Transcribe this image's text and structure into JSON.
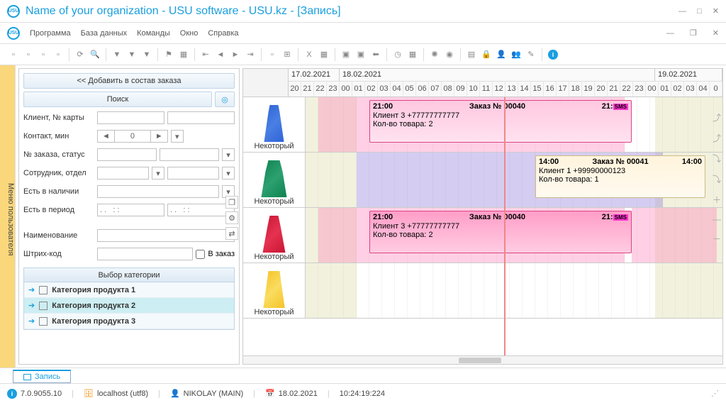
{
  "window": {
    "title": "Name of your organization - USU software - USU.kz - [Запись]"
  },
  "menu": {
    "program": "Программа",
    "database": "База данных",
    "commands": "Команды",
    "window": "Окно",
    "help": "Справка"
  },
  "sidebar_tab": "Меню пользователя",
  "left": {
    "add_to_order": "<< Добавить в состав заказа",
    "search": "Поиск",
    "client_card": "Клиент, № карты",
    "contact_min": "Контакт, мин",
    "contact_val": "0",
    "order_status": "№ заказа, статус",
    "employee_dept": "Сотрудник, отдел",
    "in_stock": "Есть в наличии",
    "in_period": "Есть в период",
    "period_ph": ". .   : :",
    "name": "Наименование",
    "barcode": "Штрих-код",
    "in_order": "В заказ",
    "cat_header": "Выбор категории",
    "cat1": "Категория продукта 1",
    "cat2": "Категория продукта 2",
    "cat3": "Категория продукта 3"
  },
  "timeline": {
    "d1": "17.02.2021",
    "d2": "18.02.2021",
    "d3": "19.02.2021",
    "resource": "Некоторый",
    "e1_start": "21:00",
    "e1_title": "Заказ № 00040",
    "e1_end": "21:",
    "e1_client": "Клиент 3 +77777777777",
    "e1_qty": "Кол-во товара: 2",
    "e2_start": "14:00",
    "e2_title": "Заказ № 00041",
    "e2_end": "14:00",
    "e2_client": "Клиент 1 +99990000123",
    "e2_qty": "Кол-во товара: 1",
    "tag": "SMS"
  },
  "tab": {
    "label": "Запись"
  },
  "status": {
    "version": "7.0.9055.10",
    "host": "localhost (utf8)",
    "user": "NIKOLAY (MAIN)",
    "date": "18.02.2021",
    "time": "10:24:19:224"
  }
}
